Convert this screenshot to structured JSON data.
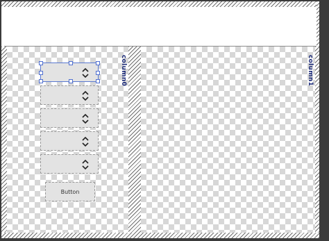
{
  "columns": [
    {
      "label": "column0"
    },
    {
      "label": "column1"
    }
  ],
  "widgets": {
    "spinners": [
      {
        "id": "spinner-1",
        "selected": true
      },
      {
        "id": "spinner-2",
        "selected": false
      },
      {
        "id": "spinner-3",
        "selected": false
      },
      {
        "id": "spinner-4",
        "selected": false
      },
      {
        "id": "spinner-5",
        "selected": false
      }
    ],
    "button_label": "Button"
  }
}
